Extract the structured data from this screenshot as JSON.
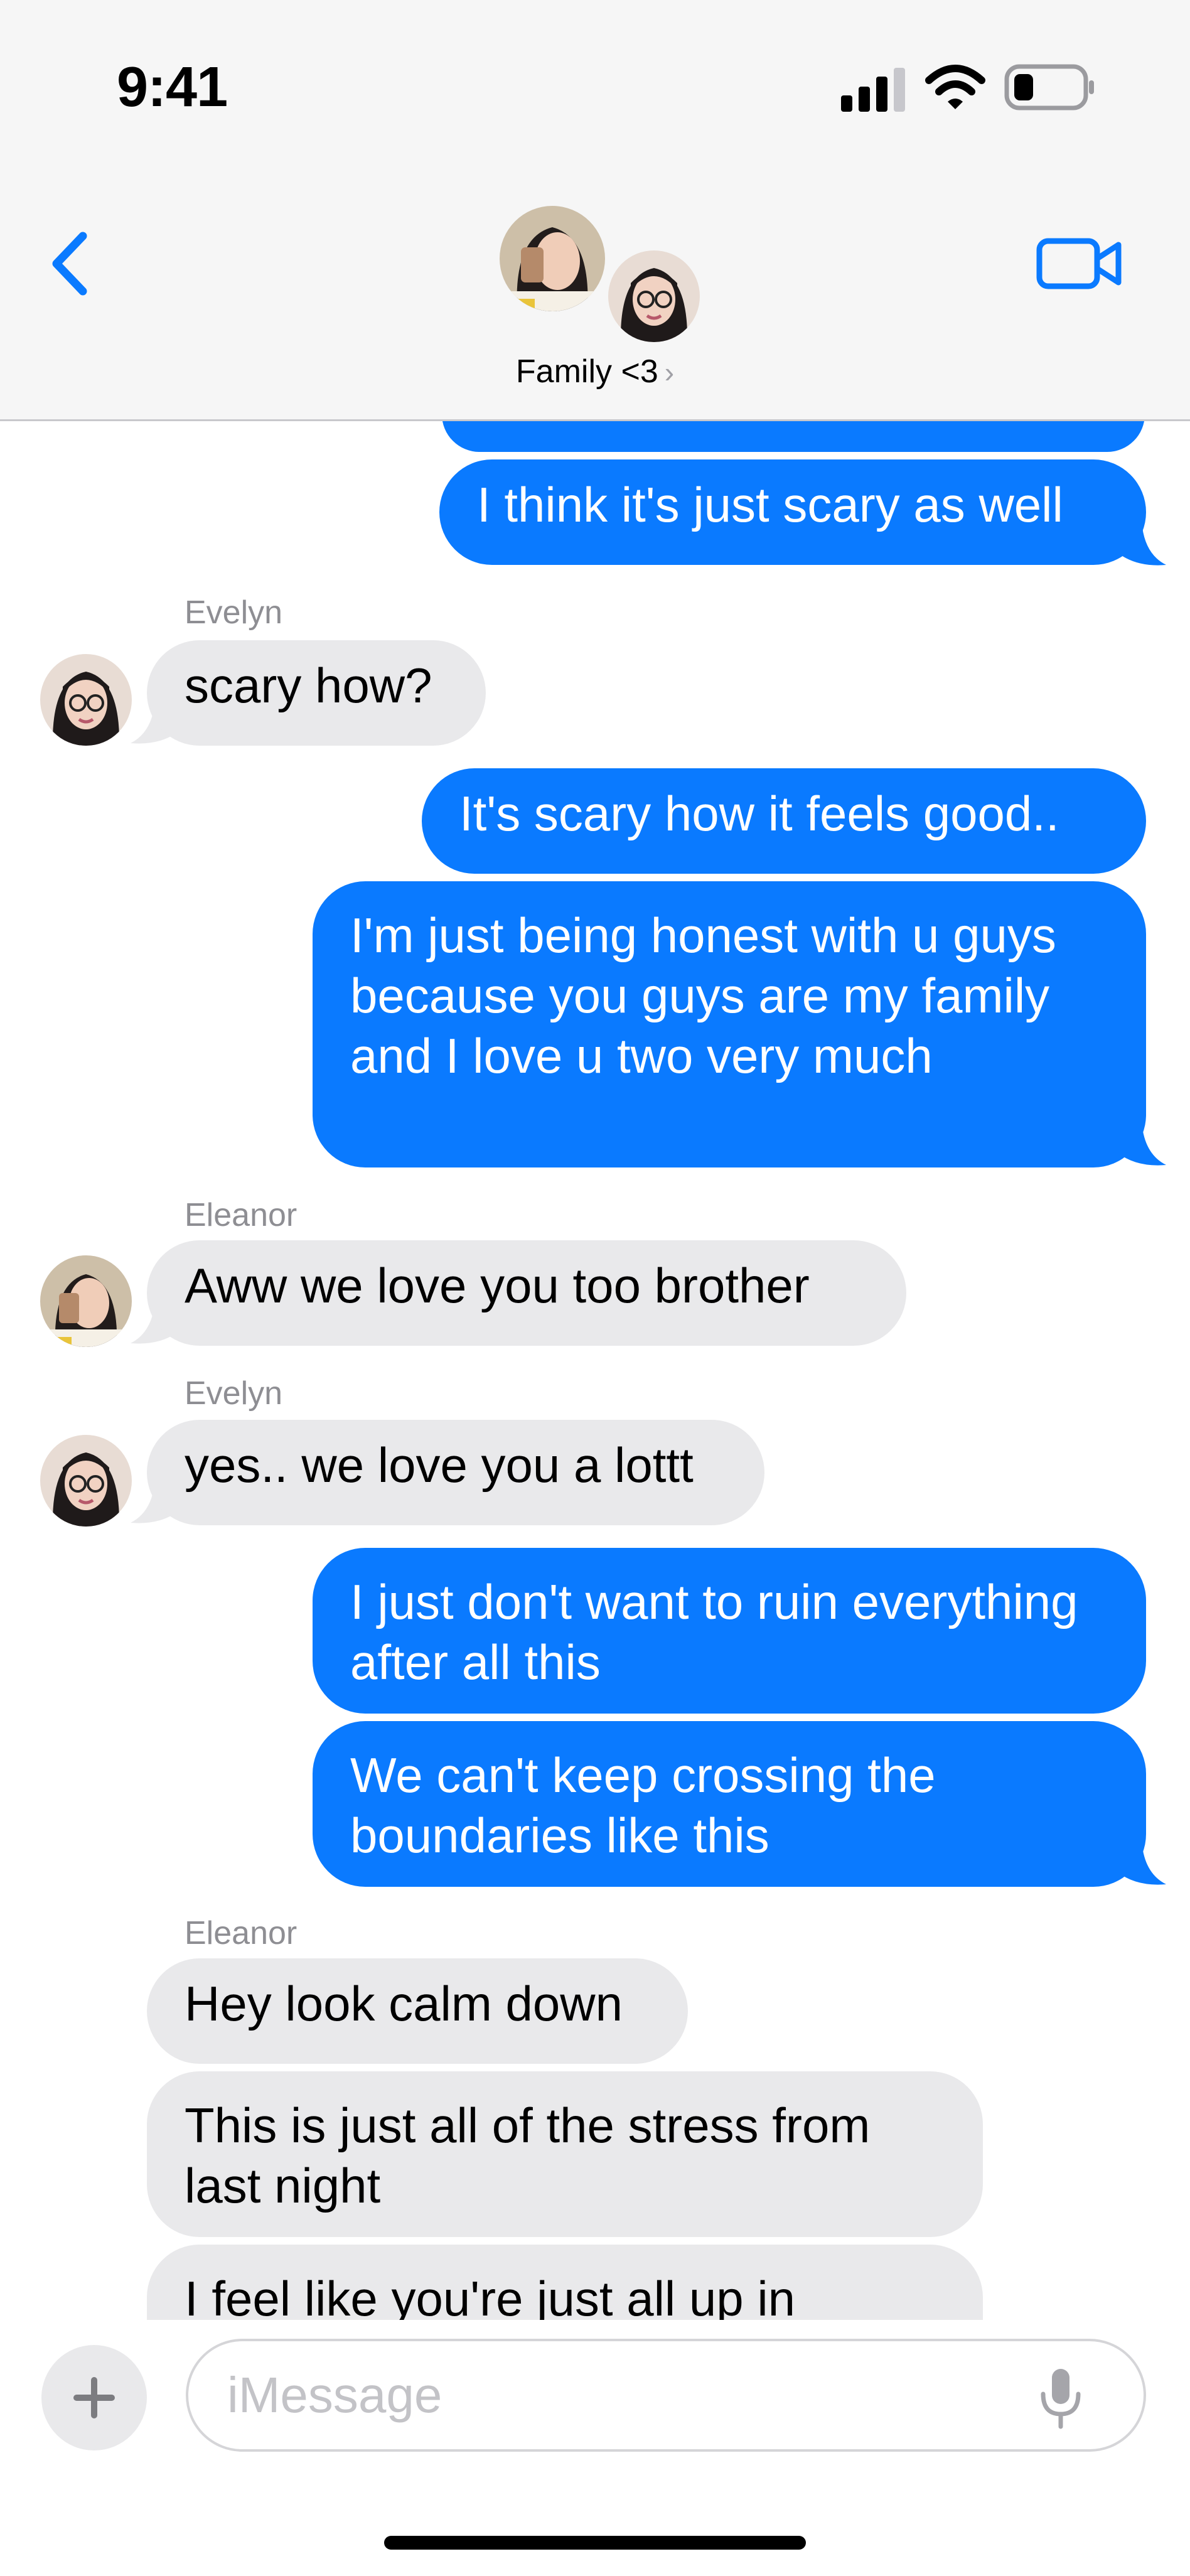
{
  "status_bar": {
    "time": "9:41"
  },
  "header": {
    "group_name": "Family <3",
    "chevron": "›"
  },
  "messages": [
    {
      "id": 0,
      "text": "I think it's just scary as well"
    },
    {
      "id": 1,
      "sender": "Evelyn",
      "text": "scary how?"
    },
    {
      "id": 2,
      "text": "It's scary how it feels good.."
    },
    {
      "id": 3,
      "text": "I'm just being honest with u guys because you guys are my family and I love u two very much"
    },
    {
      "id": 4,
      "sender": "Eleanor",
      "text": "Aww we love you too brother"
    },
    {
      "id": 5,
      "sender": "Evelyn",
      "text": "yes.. we love you a lottt"
    },
    {
      "id": 6,
      "text": "I just don't want to ruin everything after all this"
    },
    {
      "id": 7,
      "text": "We can't keep crossing the boundaries like this"
    },
    {
      "id": 8,
      "sender": "Eleanor",
      "text": "Hey look calm down"
    },
    {
      "id": 9,
      "text": "This is just all of the stress from last night"
    },
    {
      "id": 10,
      "text": "I feel like you're just all up in"
    }
  ],
  "compose": {
    "placeholder": "iMessage"
  },
  "icons": {
    "back": "chevron-left-icon",
    "video": "video-camera-icon",
    "add": "plus-icon",
    "mic": "microphone-icon"
  },
  "colors": {
    "outgoing": "#0a7aff",
    "incoming": "#e9e9eb",
    "accent": "#0a7aff"
  }
}
